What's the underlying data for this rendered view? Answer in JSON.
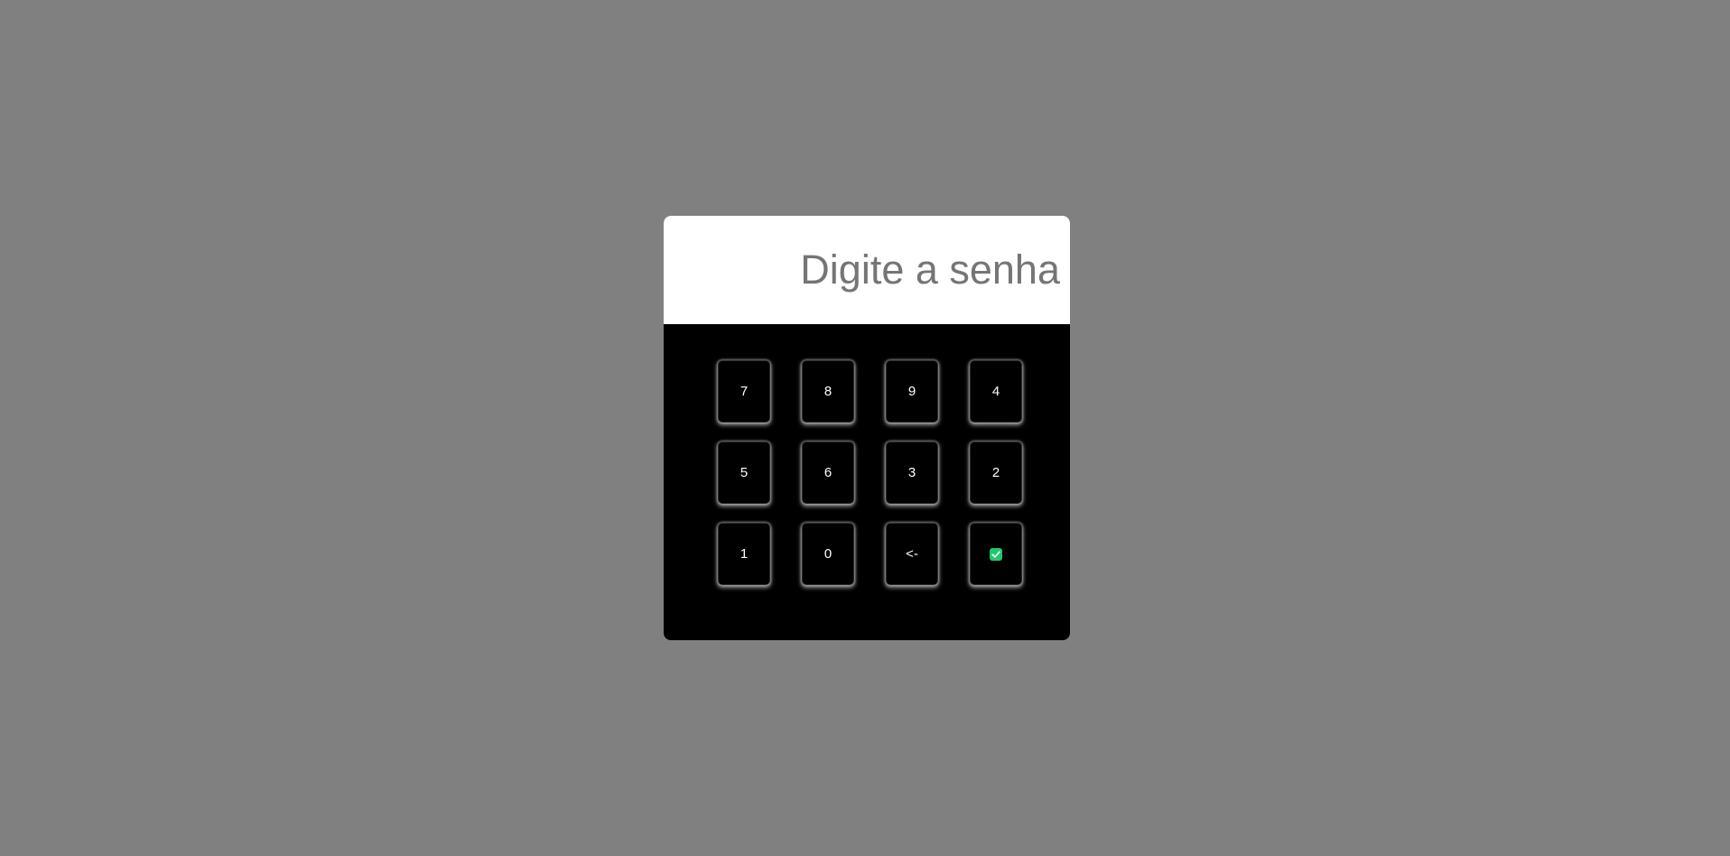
{
  "login": {
    "password_placeholder": "Digite a senha",
    "password_value": ""
  },
  "keypad": {
    "keys": [
      "7",
      "8",
      "9",
      "4",
      "5",
      "6",
      "3",
      "2",
      "1",
      "0",
      "<-"
    ],
    "confirm_icon": "check-square-icon",
    "confirm_color": "#1ec96b"
  },
  "colors": {
    "page_background": "#808080",
    "display_background": "#ffffff",
    "keypad_background": "#000000",
    "key_text": "#ffffff",
    "placeholder_text": "#757575"
  }
}
